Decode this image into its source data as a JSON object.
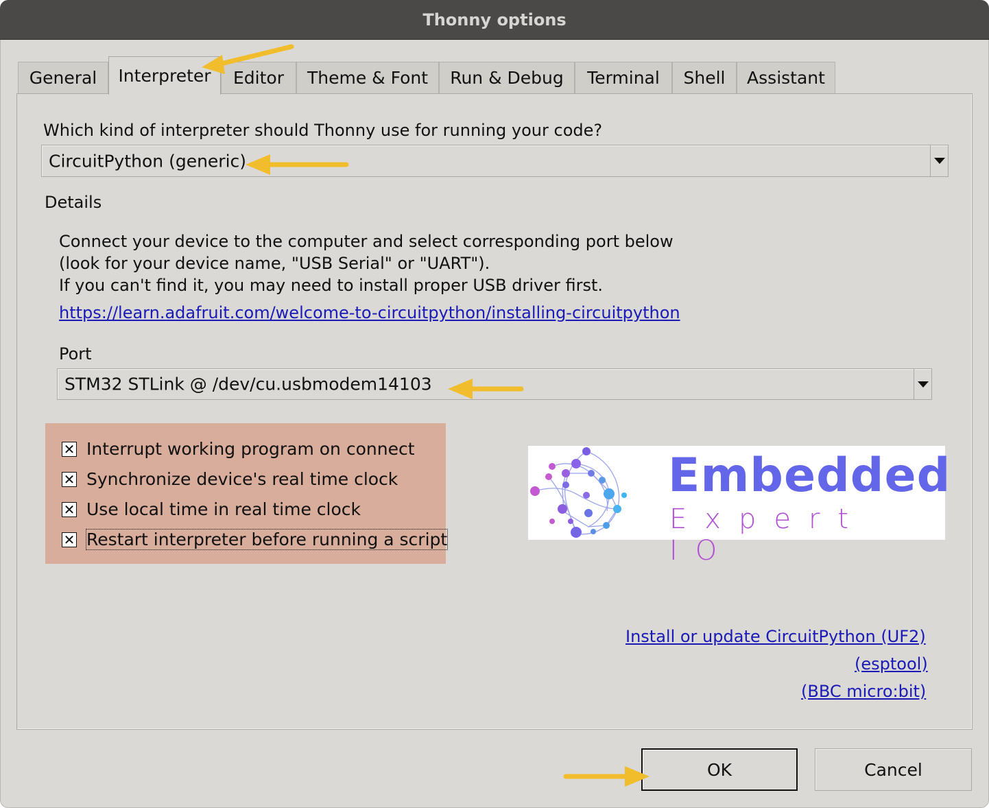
{
  "window": {
    "title": "Thonny options"
  },
  "tabs": [
    {
      "label": "General"
    },
    {
      "label": "Interpreter"
    },
    {
      "label": "Editor"
    },
    {
      "label": "Theme & Font"
    },
    {
      "label": "Run & Debug"
    },
    {
      "label": "Terminal"
    },
    {
      "label": "Shell"
    },
    {
      "label": "Assistant"
    }
  ],
  "active_tab": "Interpreter",
  "interpreter": {
    "question": "Which kind of interpreter should Thonny use for running your code?",
    "selected": "CircuitPython (generic)"
  },
  "details": {
    "heading": "Details",
    "line1": "Connect your device to the computer and select corresponding port below",
    "line2": "(look for your device name, \"USB Serial\" or \"UART\").",
    "line3": "If you can't find it, you may need to install proper USB driver first.",
    "link": "https://learn.adafruit.com/welcome-to-circuitpython/installing-circuitpython"
  },
  "port": {
    "label": "Port",
    "selected": "STM32 STLink @ /dev/cu.usbmodem14103"
  },
  "options": [
    {
      "label": "Interrupt working program on connect",
      "checked": true
    },
    {
      "label": "Synchronize device's real time clock",
      "checked": true
    },
    {
      "label": "Use local time in real time clock",
      "checked": true
    },
    {
      "label": "Restart interpreter before running a script",
      "checked": true
    }
  ],
  "checkbox_mark": "✕",
  "logo": {
    "line1": "Embedded",
    "line2": "Expert IO"
  },
  "install_links": {
    "uf2": "Install or update CircuitPython (UF2)",
    "esptool": "(esptool)",
    "microbit": "(BBC micro:bit)"
  },
  "buttons": {
    "ok": "OK",
    "cancel": "Cancel"
  },
  "colors": {
    "annotation_arrow": "#f2bd2c",
    "highlight_box": "#d9ad9b",
    "link": "#1a1ab8",
    "logo_blue": "#6366e8",
    "logo_purple": "#b14fd2"
  }
}
